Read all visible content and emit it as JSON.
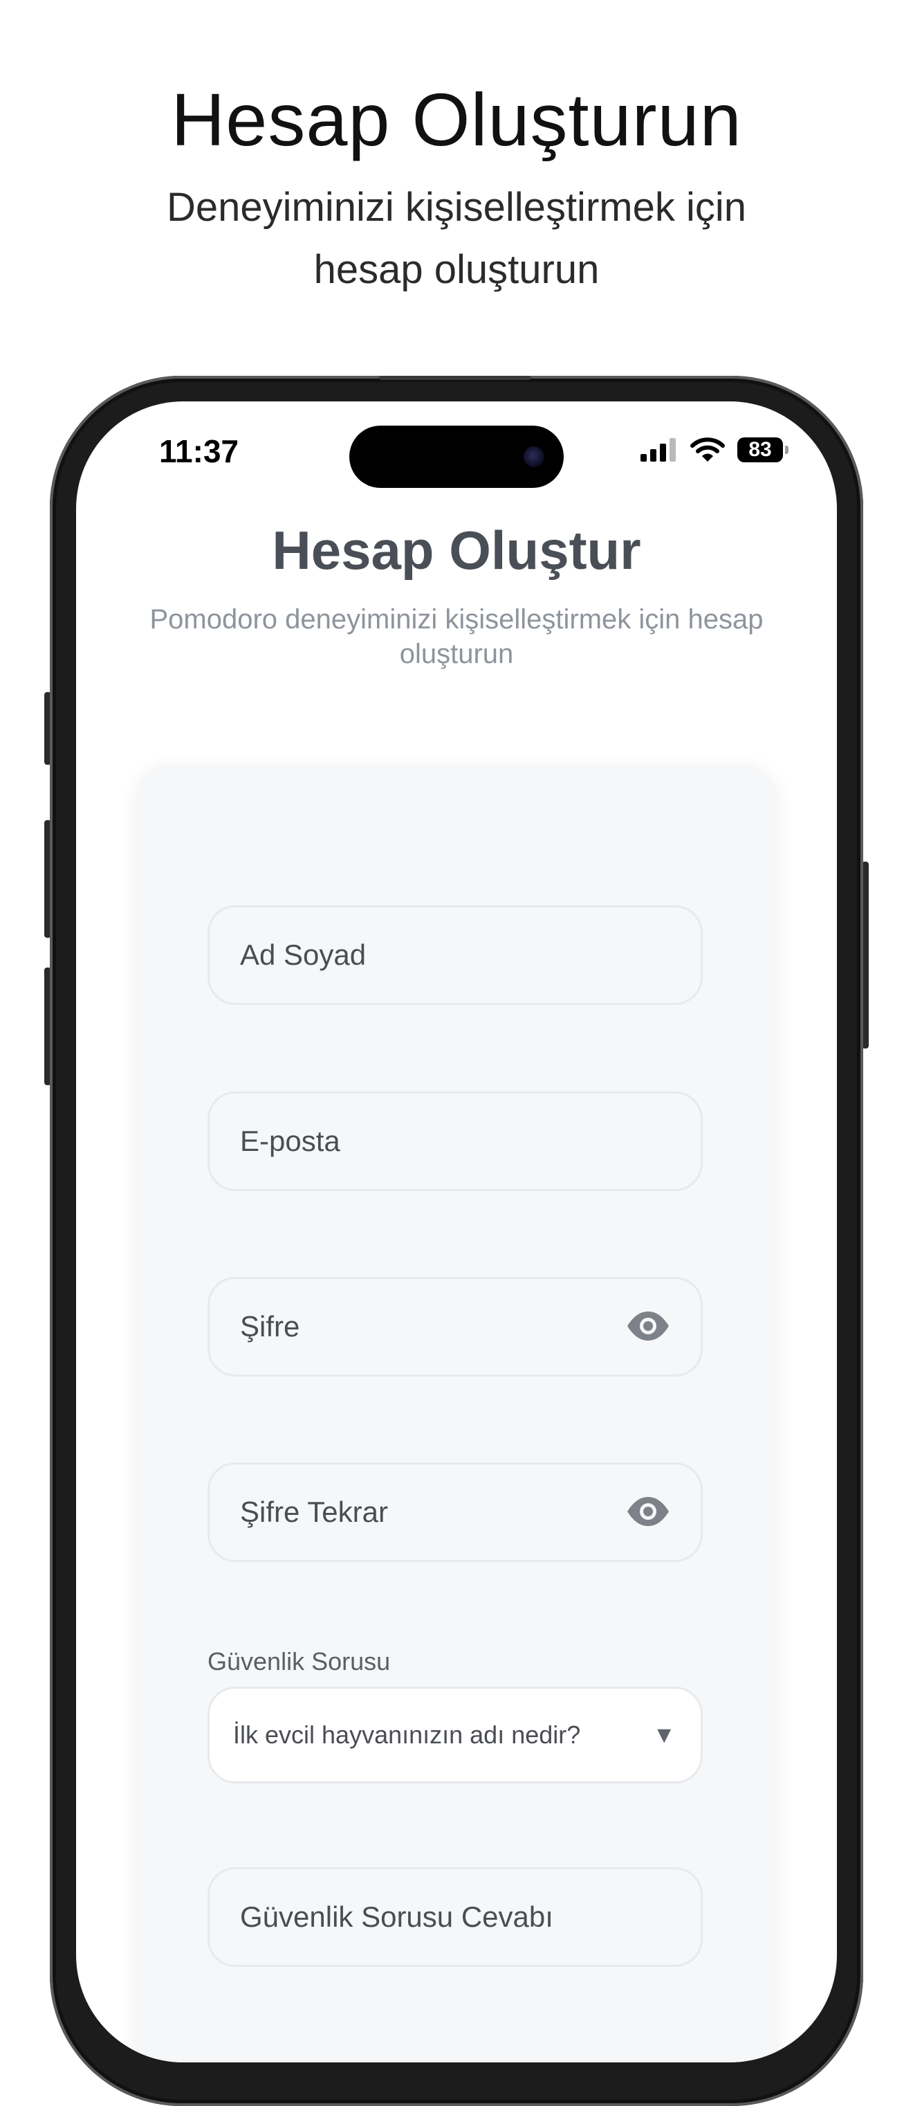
{
  "promo": {
    "title": "Hesap Oluşturun",
    "subtitle": "Deneyiminizi kişiselleştirmek için hesap oluşturun"
  },
  "status_bar": {
    "time": "11:37",
    "battery": "83",
    "icons": [
      "cellular-signal-icon",
      "wifi-icon",
      "battery-icon"
    ]
  },
  "screen": {
    "title": "Hesap Oluştur",
    "subtitle": "Pomodoro deneyiminizi kişiselleştirmek için hesap oluşturun"
  },
  "form": {
    "full_name_placeholder": "Ad Soyad",
    "email_placeholder": "E-posta",
    "password_placeholder": "Şifre",
    "password_confirm_placeholder": "Şifre Tekrar",
    "security_question_label": "Güvenlik Sorusu",
    "security_question_selected": "İlk evcil hayvanınızın adı nedir?",
    "security_answer_placeholder": "Güvenlik Sorusu Cevabı"
  },
  "colors": {
    "title_text": "#4a4f57",
    "subtitle_text": "#8e949c",
    "card_background": "#f6f7f9",
    "field_border": "#e7e9ed",
    "icon_gray": "#7d8289"
  }
}
